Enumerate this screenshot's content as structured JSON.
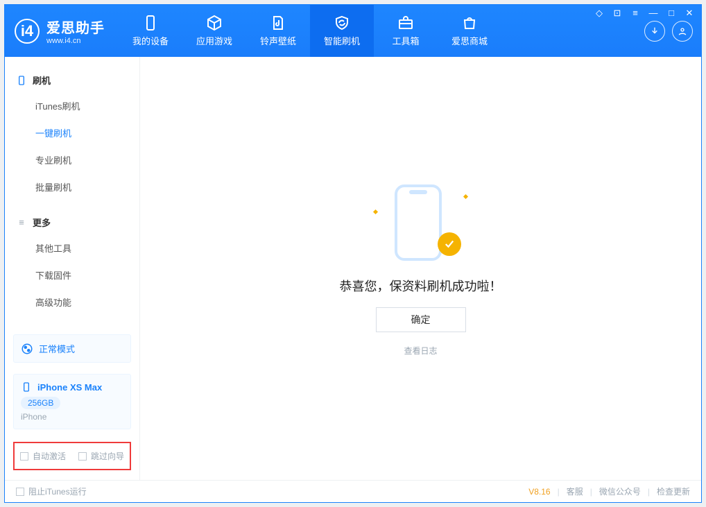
{
  "brand": {
    "name": "爱思助手",
    "url": "www.i4.cn"
  },
  "nav": [
    {
      "label": "我的设备"
    },
    {
      "label": "应用游戏"
    },
    {
      "label": "铃声壁纸"
    },
    {
      "label": "智能刷机",
      "active": true
    },
    {
      "label": "工具箱"
    },
    {
      "label": "爱思商城"
    }
  ],
  "sidebar": {
    "section_flash": "刷机",
    "flash_items": [
      {
        "label": "iTunes刷机"
      },
      {
        "label": "一键刷机",
        "active": true
      },
      {
        "label": "专业刷机"
      },
      {
        "label": "批量刷机"
      }
    ],
    "section_more": "更多",
    "more_items": [
      {
        "label": "其他工具"
      },
      {
        "label": "下载固件"
      },
      {
        "label": "高级功能"
      }
    ],
    "mode_label": "正常模式",
    "device": {
      "name": "iPhone XS Max",
      "storage": "256GB",
      "type": "iPhone"
    },
    "opts": {
      "auto_activate": "自动激活",
      "skip_guide": "跳过向导"
    }
  },
  "main": {
    "message": "恭喜您，保资料刷机成功啦！",
    "ok": "确定",
    "view_log": "查看日志"
  },
  "footer": {
    "block_itunes": "阻止iTunes运行",
    "version": "V8.16",
    "links": {
      "support": "客服",
      "wechat": "微信公众号",
      "check_update": "检查更新"
    }
  }
}
